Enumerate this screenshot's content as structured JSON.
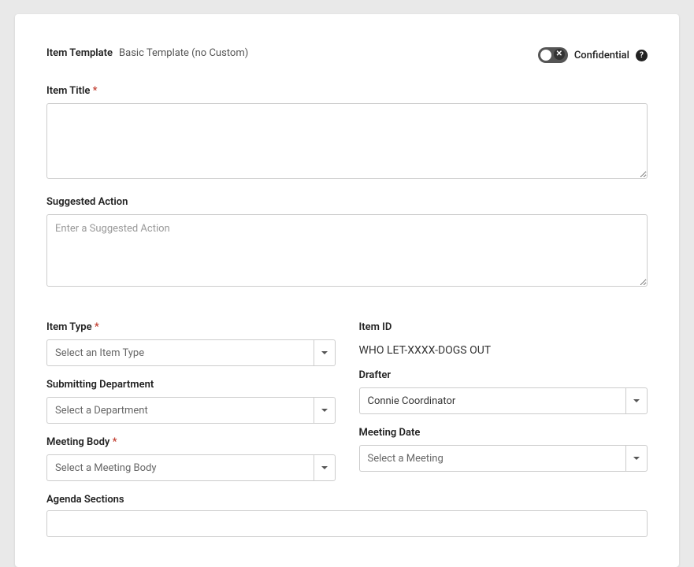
{
  "template": {
    "label": "Item Template",
    "value": "Basic Template (no Custom)"
  },
  "confidential": {
    "label": "Confidential"
  },
  "fields": {
    "title": {
      "label": "Item Title",
      "required": "*"
    },
    "suggestedAction": {
      "label": "Suggested Action",
      "placeholder": "Enter a Suggested Action"
    },
    "itemType": {
      "label": "Item Type",
      "required": "*",
      "placeholder": "Select an Item Type"
    },
    "itemId": {
      "label": "Item ID",
      "value": "WHO LET-XXXX-DOGS OUT"
    },
    "submittingDept": {
      "label": "Submitting Department",
      "placeholder": "Select a Department"
    },
    "drafter": {
      "label": "Drafter",
      "value": "Connie Coordinator"
    },
    "meetingBody": {
      "label": "Meeting Body",
      "required": "*",
      "placeholder": "Select a Meeting Body"
    },
    "meetingDate": {
      "label": "Meeting Date",
      "placeholder": "Select a Meeting"
    },
    "agendaSections": {
      "label": "Agenda Sections"
    }
  }
}
